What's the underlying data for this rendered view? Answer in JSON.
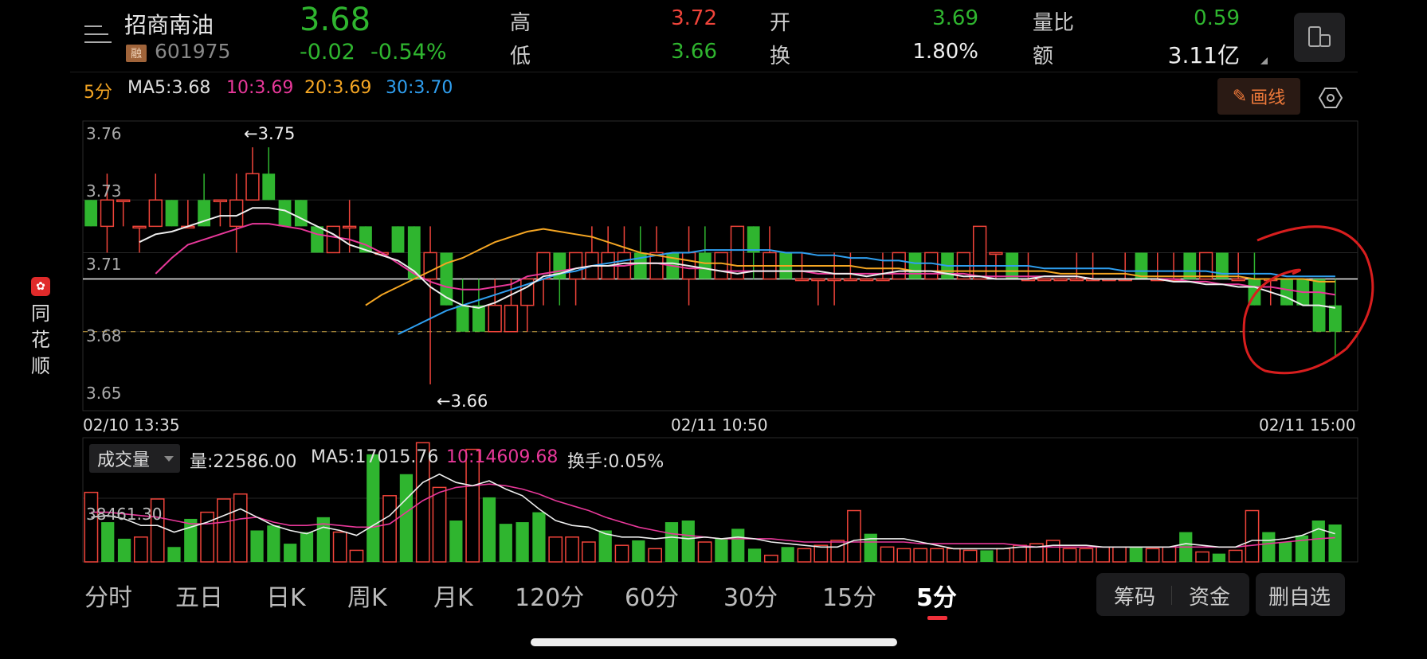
{
  "app": {
    "brand_chars": [
      "同",
      "花",
      "顺"
    ],
    "brand_logo": "✿"
  },
  "stock": {
    "name": "招商南油",
    "tag": "融",
    "code": "601975",
    "price": "3.68",
    "change": "-0.02",
    "change_pct": "-0.54%"
  },
  "quote": {
    "high_label": "高",
    "high": "3.72",
    "low_label": "低",
    "low": "3.66",
    "open_label": "开",
    "open": "3.69",
    "turnover_label": "换",
    "turnover": "1.80%",
    "vol_ratio_label": "量比",
    "vol_ratio": "0.59",
    "amount_label": "额",
    "amount": "3.11亿"
  },
  "indicators": {
    "period": "5分",
    "ma5": "MA5:3.68",
    "ma10": "10:3.69",
    "ma20": "20:3.69",
    "ma30": "30:3.70",
    "draw_button": "画线"
  },
  "colors": {
    "up": "#f0443a",
    "down": "#2fb52f",
    "ma5": "#eeeeee",
    "ma10": "#e8389a",
    "ma20": "#f5a623",
    "ma30": "#2f9ff0",
    "annotation": "#d81e1e"
  },
  "chart_data": [
    {
      "type": "candlestick",
      "y_ticks": [
        "3.76",
        "3.73",
        "3.71",
        "3.68",
        "3.65"
      ],
      "x_labels": [
        "02/10 13:35",
        "02/11 10:50",
        "02/11 15:00"
      ],
      "annotations": [
        "←3.75",
        "←3.66"
      ],
      "ylim": [
        3.65,
        3.76
      ],
      "prev_close": 3.7,
      "current": 3.68,
      "candles": [
        [
          3.73,
          3.72,
          3.73,
          3.72
        ],
        [
          3.72,
          3.73,
          3.74,
          3.71
        ],
        [
          3.73,
          3.73,
          3.73,
          3.72
        ],
        [
          3.72,
          3.72,
          3.72,
          3.71
        ],
        [
          3.72,
          3.73,
          3.74,
          3.72
        ],
        [
          3.73,
          3.72,
          3.73,
          3.72
        ],
        [
          3.72,
          3.72,
          3.73,
          3.72
        ],
        [
          3.73,
          3.72,
          3.74,
          3.72
        ],
        [
          3.73,
          3.73,
          3.73,
          3.72
        ],
        [
          3.72,
          3.73,
          3.74,
          3.71
        ],
        [
          3.73,
          3.74,
          3.75,
          3.73
        ],
        [
          3.74,
          3.73,
          3.75,
          3.73
        ],
        [
          3.73,
          3.72,
          3.73,
          3.72
        ],
        [
          3.73,
          3.72,
          3.73,
          3.72
        ],
        [
          3.72,
          3.71,
          3.72,
          3.71
        ],
        [
          3.71,
          3.72,
          3.72,
          3.71
        ],
        [
          3.72,
          3.72,
          3.73,
          3.71
        ],
        [
          3.72,
          3.71,
          3.72,
          3.71
        ],
        [
          3.71,
          3.71,
          3.71,
          3.71
        ],
        [
          3.72,
          3.71,
          3.72,
          3.71
        ],
        [
          3.72,
          3.7,
          3.72,
          3.7
        ],
        [
          3.7,
          3.71,
          3.72,
          3.66
        ],
        [
          3.71,
          3.69,
          3.71,
          3.69
        ],
        [
          3.69,
          3.68,
          3.7,
          3.68
        ],
        [
          3.69,
          3.68,
          3.7,
          3.68
        ],
        [
          3.68,
          3.69,
          3.7,
          3.68
        ],
        [
          3.68,
          3.69,
          3.7,
          3.68
        ],
        [
          3.69,
          3.7,
          3.7,
          3.68
        ],
        [
          3.7,
          3.71,
          3.71,
          3.69
        ],
        [
          3.71,
          3.7,
          3.71,
          3.69
        ],
        [
          3.7,
          3.71,
          3.71,
          3.69
        ],
        [
          3.7,
          3.71,
          3.72,
          3.7
        ],
        [
          3.7,
          3.71,
          3.72,
          3.7
        ],
        [
          3.7,
          3.71,
          3.72,
          3.7
        ],
        [
          3.71,
          3.7,
          3.72,
          3.7
        ],
        [
          3.7,
          3.71,
          3.72,
          3.7
        ],
        [
          3.71,
          3.7,
          3.71,
          3.7
        ],
        [
          3.7,
          3.71,
          3.72,
          3.69
        ],
        [
          3.71,
          3.7,
          3.72,
          3.7
        ],
        [
          3.7,
          3.71,
          3.71,
          3.7
        ],
        [
          3.7,
          3.72,
          3.72,
          3.7
        ],
        [
          3.72,
          3.71,
          3.72,
          3.7
        ],
        [
          3.7,
          3.71,
          3.72,
          3.7
        ],
        [
          3.71,
          3.7,
          3.71,
          3.7
        ],
        [
          3.7,
          3.7,
          3.71,
          3.7
        ],
        [
          3.7,
          3.7,
          3.7,
          3.69
        ],
        [
          3.7,
          3.7,
          3.71,
          3.69
        ],
        [
          3.7,
          3.7,
          3.71,
          3.7
        ],
        [
          3.7,
          3.7,
          3.7,
          3.7
        ],
        [
          3.7,
          3.7,
          3.71,
          3.7
        ],
        [
          3.7,
          3.71,
          3.71,
          3.7
        ],
        [
          3.71,
          3.7,
          3.71,
          3.7
        ],
        [
          3.7,
          3.71,
          3.71,
          3.7
        ],
        [
          3.71,
          3.7,
          3.71,
          3.7
        ],
        [
          3.7,
          3.71,
          3.71,
          3.7
        ],
        [
          3.7,
          3.72,
          3.72,
          3.7
        ],
        [
          3.71,
          3.71,
          3.71,
          3.7
        ],
        [
          3.71,
          3.7,
          3.71,
          3.7
        ],
        [
          3.7,
          3.7,
          3.71,
          3.7
        ],
        [
          3.7,
          3.7,
          3.7,
          3.7
        ],
        [
          3.7,
          3.7,
          3.7,
          3.7
        ],
        [
          3.7,
          3.7,
          3.71,
          3.7
        ],
        [
          3.7,
          3.7,
          3.71,
          3.7
        ],
        [
          3.7,
          3.7,
          3.7,
          3.7
        ],
        [
          3.7,
          3.7,
          3.71,
          3.7
        ],
        [
          3.71,
          3.7,
          3.71,
          3.7
        ],
        [
          3.7,
          3.7,
          3.71,
          3.7
        ],
        [
          3.7,
          3.7,
          3.71,
          3.7
        ],
        [
          3.71,
          3.7,
          3.71,
          3.7
        ],
        [
          3.7,
          3.71,
          3.71,
          3.7
        ],
        [
          3.71,
          3.7,
          3.71,
          3.7
        ],
        [
          3.7,
          3.7,
          3.71,
          3.7
        ],
        [
          3.7,
          3.69,
          3.71,
          3.69
        ],
        [
          3.7,
          3.7,
          3.7,
          3.69
        ],
        [
          3.7,
          3.69,
          3.7,
          3.69
        ],
        [
          3.7,
          3.69,
          3.7,
          3.69
        ],
        [
          3.7,
          3.68,
          3.7,
          3.68
        ],
        [
          3.69,
          3.68,
          3.7,
          3.67
        ]
      ],
      "ma5": [
        3.714,
        3.717,
        3.718,
        3.72,
        3.722,
        3.724,
        3.724,
        3.727,
        3.727,
        3.726,
        3.723,
        3.72,
        3.717,
        3.713,
        3.711,
        3.709,
        3.707,
        3.703,
        3.697,
        3.693,
        3.69,
        3.689,
        3.691,
        3.694,
        3.697,
        3.701,
        3.702,
        3.704,
        3.705,
        3.705,
        3.706,
        3.706,
        3.706,
        3.706,
        3.705,
        3.704,
        3.703,
        3.702,
        3.703,
        3.703,
        3.703,
        3.703,
        3.703,
        3.702,
        3.702,
        3.701,
        3.702,
        3.703,
        3.703,
        3.703,
        3.702,
        3.701,
        3.701,
        3.7,
        3.7,
        3.7,
        3.701,
        3.701,
        3.701,
        3.7,
        3.7,
        3.7,
        3.7,
        3.7,
        3.699,
        3.699,
        3.698,
        3.698,
        3.697,
        3.697,
        3.695,
        3.693,
        3.69,
        3.69,
        3.689
      ],
      "ma10": [
        3.702,
        3.708,
        3.713,
        3.715,
        3.717,
        3.719,
        3.721,
        3.721,
        3.72,
        3.719,
        3.717,
        3.716,
        3.715,
        3.713,
        3.71,
        3.706,
        3.702,
        3.699,
        3.697,
        3.696,
        3.696,
        3.697,
        3.698,
        3.701,
        3.702,
        3.703,
        3.704,
        3.705,
        3.705,
        3.705,
        3.706,
        3.706,
        3.705,
        3.704,
        3.704,
        3.703,
        3.703,
        3.703,
        3.703,
        3.703,
        3.703,
        3.702,
        3.702,
        3.702,
        3.702,
        3.702,
        3.702,
        3.702,
        3.702,
        3.702,
        3.702,
        3.701,
        3.701,
        3.701,
        3.701,
        3.701,
        3.701,
        3.701,
        3.7,
        3.7,
        3.7,
        3.7,
        3.7,
        3.7,
        3.699,
        3.699,
        3.698,
        3.698,
        3.697,
        3.697,
        3.696,
        3.695,
        3.695,
        3.694
      ],
      "ma20": [
        3.69,
        3.694,
        3.697,
        3.7,
        3.703,
        3.706,
        3.708,
        3.711,
        3.714,
        3.716,
        3.718,
        3.719,
        3.718,
        3.717,
        3.716,
        3.714,
        3.712,
        3.71,
        3.709,
        3.708,
        3.707,
        3.706,
        3.706,
        3.705,
        3.705,
        3.705,
        3.705,
        3.705,
        3.705,
        3.705,
        3.705,
        3.704,
        3.704,
        3.704,
        3.703,
        3.703,
        3.703,
        3.703,
        3.703,
        3.703,
        3.703,
        3.703,
        3.703,
        3.702,
        3.702,
        3.702,
        3.702,
        3.702,
        3.701,
        3.701,
        3.701,
        3.701,
        3.701,
        3.701,
        3.701,
        3.7,
        3.7,
        3.7,
        3.7,
        3.699,
        3.699
      ],
      "ma30": [
        3.679,
        3.682,
        3.685,
        3.688,
        3.69,
        3.692,
        3.694,
        3.696,
        3.698,
        3.7,
        3.702,
        3.703,
        3.705,
        3.706,
        3.707,
        3.708,
        3.709,
        3.71,
        3.71,
        3.711,
        3.711,
        3.711,
        3.711,
        3.711,
        3.71,
        3.71,
        3.709,
        3.709,
        3.708,
        3.708,
        3.707,
        3.707,
        3.706,
        3.706,
        3.705,
        3.705,
        3.705,
        3.705,
        3.705,
        3.705,
        3.704,
        3.704,
        3.704,
        3.704,
        3.704,
        3.703,
        3.703,
        3.703,
        3.703,
        3.703,
        3.703,
        3.702,
        3.702,
        3.702,
        3.702,
        3.701,
        3.701,
        3.701,
        3.701
      ]
    },
    {
      "type": "bar",
      "title": "成交量",
      "label_volume": "量:22586.00",
      "label_ma5": "MA5:17015.76",
      "label_ma10": "10:14609.68",
      "label_turnover": "换手:0.05%",
      "y_tick": "38461.30",
      "ylim": [
        0,
        75000
      ],
      "values": [
        42000,
        24000,
        14000,
        15000,
        38000,
        9000,
        26000,
        30000,
        38000,
        41000,
        19000,
        22000,
        11000,
        18000,
        27000,
        18000,
        7000,
        65000,
        40000,
        53000,
        72000,
        45000,
        25000,
        68000,
        39000,
        23000,
        24000,
        30000,
        15000,
        15000,
        12000,
        19000,
        10000,
        13000,
        8000,
        24000,
        25000,
        12000,
        14000,
        20000,
        8000,
        4000,
        9000,
        8000,
        10000,
        13000,
        31000,
        17000,
        9000,
        8000,
        8000,
        8000,
        8000,
        7000,
        7000,
        8000,
        10000,
        11000,
        13000,
        8000,
        8000,
        9000,
        9000,
        9000,
        8000,
        9000,
        18000,
        6000,
        5000,
        7000,
        31000,
        18000,
        12000,
        16000,
        25000,
        22586
      ],
      "up": [
        1,
        0,
        0,
        1,
        1,
        0,
        0,
        1,
        1,
        1,
        0,
        0,
        0,
        0,
        0,
        1,
        1,
        0,
        1,
        0,
        1,
        1,
        0,
        1,
        0,
        0,
        0,
        0,
        1,
        1,
        1,
        0,
        1,
        0,
        1,
        0,
        0,
        1,
        0,
        0,
        0,
        1,
        0,
        1,
        1,
        1,
        1,
        0,
        1,
        1,
        1,
        1,
        1,
        1,
        0,
        1,
        1,
        1,
        1,
        1,
        1,
        1,
        1,
        0,
        1,
        1,
        0,
        1,
        0,
        1,
        1,
        0,
        0,
        0,
        0,
        0
      ],
      "ma5": [
        27000,
        28000,
        26000,
        22000,
        22000,
        18000,
        21000,
        24000,
        28000,
        32000,
        27000,
        22000,
        19000,
        17000,
        21000,
        19000,
        16000,
        22000,
        28000,
        38000,
        48000,
        53000,
        48000,
        46000,
        49000,
        44000,
        40000,
        32000,
        25000,
        22000,
        21000,
        17000,
        15000,
        15000,
        14000,
        15000,
        14000,
        15000,
        14000,
        15000,
        14000,
        12000,
        11000,
        10000,
        9000,
        9000,
        13000,
        14000,
        14000,
        14000,
        12000,
        10000,
        8000,
        8000,
        8000,
        8000,
        9000,
        9000,
        10000,
        10000,
        10000,
        9000,
        9000,
        9000,
        9000,
        9000,
        11000,
        10000,
        9000,
        9000,
        13000,
        13000,
        14000,
        16000,
        20000,
        17016
      ],
      "ma10": [
        30000,
        30000,
        29000,
        28000,
        27000,
        25000,
        23000,
        23000,
        24000,
        26000,
        27000,
        24000,
        22000,
        22000,
        23000,
        22000,
        21000,
        21000,
        23000,
        30000,
        37000,
        42000,
        45000,
        46000,
        47000,
        46000,
        44000,
        41000,
        37000,
        34000,
        31000,
        27000,
        24000,
        21000,
        19000,
        17000,
        16000,
        15000,
        14000,
        14000,
        14000,
        14000,
        13000,
        12000,
        12000,
        12000,
        12000,
        12000,
        12000,
        12000,
        11000,
        11000,
        11000,
        11000,
        11000,
        11000,
        10000,
        9000,
        9000,
        9000,
        9000,
        9000,
        9000,
        9000,
        9000,
        9000,
        9000,
        9000,
        9000,
        9000,
        10000,
        11000,
        12000,
        13000,
        14000,
        14610
      ]
    }
  ],
  "volume_menu": {
    "arrow_icon": "caret-down-icon"
  },
  "tabs": [
    "分时",
    "五日",
    "日K",
    "周K",
    "月K",
    "120分",
    "60分",
    "30分",
    "15分",
    "5分"
  ],
  "active_tab": "5分",
  "actions": {
    "chips": "筹码",
    "funds": "资金",
    "remove": "删自选"
  }
}
